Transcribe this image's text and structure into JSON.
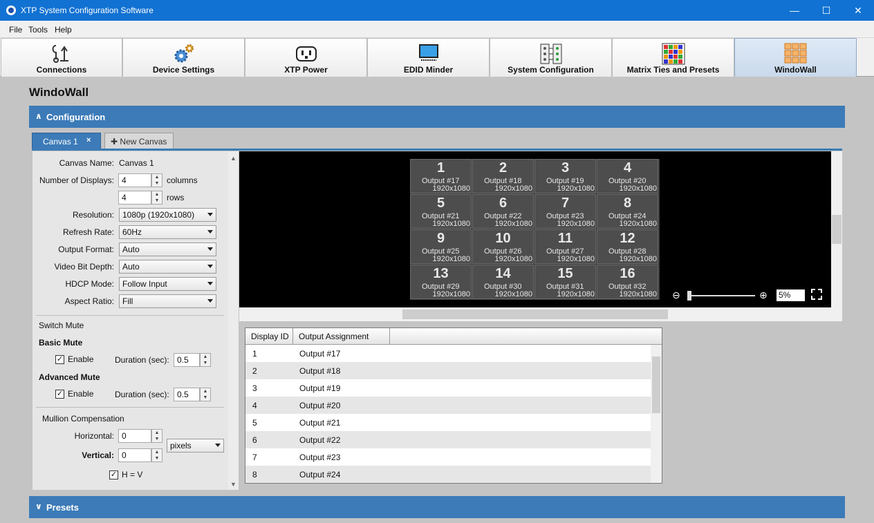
{
  "window": {
    "title": "XTP System Configuration Software",
    "minimize": "—",
    "maximize": "☐",
    "close": "✕"
  },
  "menu": [
    "File",
    "Tools",
    "Help"
  ],
  "toolbar": [
    {
      "label": "Connections",
      "icon": "connections-icon"
    },
    {
      "label": "Device Settings",
      "icon": "gears-icon"
    },
    {
      "label": "XTP Power",
      "icon": "power-plug-icon"
    },
    {
      "label": "EDID Minder",
      "icon": "monitor-icon"
    },
    {
      "label": "System Configuration",
      "icon": "system-config-icon"
    },
    {
      "label": "Matrix Ties and Presets",
      "icon": "matrix-grid-icon"
    },
    {
      "label": "WindoWall",
      "icon": "windowall-icon",
      "active": true
    }
  ],
  "page": {
    "title": "WindoWall",
    "configuration_section": "Configuration",
    "presets_section": "Presets",
    "expanded_chevron": "∧",
    "collapsed_chevron": "∨"
  },
  "tabs": {
    "active": "Canvas 1",
    "close": "×",
    "new_canvas": "New Canvas",
    "plus": "✚"
  },
  "config": {
    "canvas_name_label": "Canvas Name:",
    "canvas_name": "Canvas 1",
    "num_displays_label": "Number of Displays:",
    "columns_value": "4",
    "columns_unit": "columns",
    "rows_value": "4",
    "rows_unit": "rows",
    "resolution_label": "Resolution:",
    "resolution": "1080p (1920x1080)",
    "refresh_label": "Refresh Rate:",
    "refresh": "60Hz",
    "output_format_label": "Output Format:",
    "output_format": "Auto",
    "bit_depth_label": "Video Bit Depth:",
    "bit_depth": "Auto",
    "hdcp_label": "HDCP Mode:",
    "hdcp": "Follow Input",
    "aspect_label": "Aspect Ratio:",
    "aspect": "Fill",
    "switch_mute": "Switch Mute",
    "basic_mute": "Basic Mute",
    "advanced_mute": "Advanced Mute",
    "enable_label": "Enable",
    "duration_label": "Duration (sec):",
    "basic_duration": "0.5",
    "advanced_duration": "0.5",
    "mullion": "Mullion Compensation",
    "horizontal_label": "Horizontal:",
    "horizontal": "0",
    "vertical_label": "Vertical:",
    "vertical": "0",
    "units": "pixels",
    "hv_label": "H = V",
    "check": "✓",
    "up": "▲",
    "down": "▼"
  },
  "canvas_preview": {
    "cells": [
      {
        "num": "1",
        "output": "Output #17",
        "res": "1920x1080"
      },
      {
        "num": "2",
        "output": "Output #18",
        "res": "1920x1080"
      },
      {
        "num": "3",
        "output": "Output #19",
        "res": "1920x1080"
      },
      {
        "num": "4",
        "output": "Output #20",
        "res": "1920x1080"
      },
      {
        "num": "5",
        "output": "Output #21",
        "res": "1920x1080"
      },
      {
        "num": "6",
        "output": "Output #22",
        "res": "1920x1080"
      },
      {
        "num": "7",
        "output": "Output #23",
        "res": "1920x1080"
      },
      {
        "num": "8",
        "output": "Output #24",
        "res": "1920x1080"
      },
      {
        "num": "9",
        "output": "Output #25",
        "res": "1920x1080"
      },
      {
        "num": "10",
        "output": "Output #26",
        "res": "1920x1080"
      },
      {
        "num": "11",
        "output": "Output #27",
        "res": "1920x1080"
      },
      {
        "num": "12",
        "output": "Output #28",
        "res": "1920x1080"
      },
      {
        "num": "13",
        "output": "Output #29",
        "res": "1920x1080"
      },
      {
        "num": "14",
        "output": "Output #30",
        "res": "1920x1080"
      },
      {
        "num": "15",
        "output": "Output #31",
        "res": "1920x1080"
      },
      {
        "num": "16",
        "output": "Output #32",
        "res": "1920x1080"
      }
    ],
    "zoom": "5%",
    "zoom_out": "⊖",
    "zoom_in": "⊕"
  },
  "table": {
    "headers": [
      "Display ID",
      "Output Assignment"
    ],
    "rows": [
      [
        "1",
        "Output #17"
      ],
      [
        "2",
        "Output #18"
      ],
      [
        "3",
        "Output #19"
      ],
      [
        "4",
        "Output #20"
      ],
      [
        "5",
        "Output #21"
      ],
      [
        "6",
        "Output #22"
      ],
      [
        "7",
        "Output #23"
      ],
      [
        "8",
        "Output #24"
      ]
    ]
  },
  "colors": {
    "titlebar": "#1172d3",
    "section": "#3c7bb8",
    "active_tool": "#c9d9ec"
  }
}
